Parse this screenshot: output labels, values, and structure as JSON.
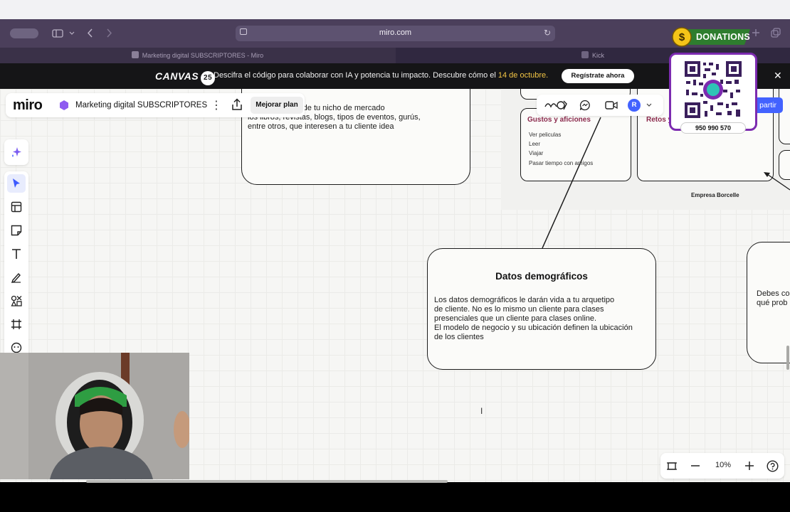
{
  "menubar": {
    "apple": ""
  },
  "browser": {
    "url": "miro.com",
    "tabs": [
      {
        "label": "Marketing digital SUBSCRIPTORES - Miro"
      },
      {
        "label": "Kick"
      }
    ]
  },
  "promo": {
    "brand": "CANVAS",
    "brand_num": "25",
    "message_pre": "Descifra el código para colaborar con IA y potencia tu impacto. Descubre cómo el ",
    "message_date": "14 de octubre.",
    "cta": "Regístrate ahora"
  },
  "board": {
    "logo": "miro",
    "name": "Marketing digital SUBSCRIPTORES",
    "upgrade": "Mejorar plan",
    "share": "partir"
  },
  "cards": {
    "top_left_text": "ncontrar dentro de tu nicho de mercado\nlos libros, revistas, blogs, tipos de eventos, gurús,\nentre otros, que interesen a tu cliente idea",
    "gustos_title": "Gustos y aficiones",
    "gustos_items": [
      "Ver peliculas",
      "Leer",
      "Viajar",
      "Pasar tiempo con amigos"
    ],
    "retos_title": "Retos y",
    "company": "Empresa Borcelle",
    "demo_title": "Datos demográficos",
    "demo_text": "Los datos demográficos le darán vida a tu arquetipo\nde cliente. No es lo mismo un cliente para clases\npresenciales que un cliente para clases online.\nEl modelo de negocio y su ubicación definen la ubicación\nde los clientes",
    "right_text": "Debes co\nqué prob"
  },
  "collab": {
    "avatar": "R"
  },
  "zoom": {
    "value": "10%"
  },
  "donate": {
    "label": "DONATIONS",
    "phone": "950 990 570"
  },
  "colors": {
    "accent": "#4262ff",
    "promo_date": "#f3c545",
    "browser": "#4b3f5b"
  }
}
